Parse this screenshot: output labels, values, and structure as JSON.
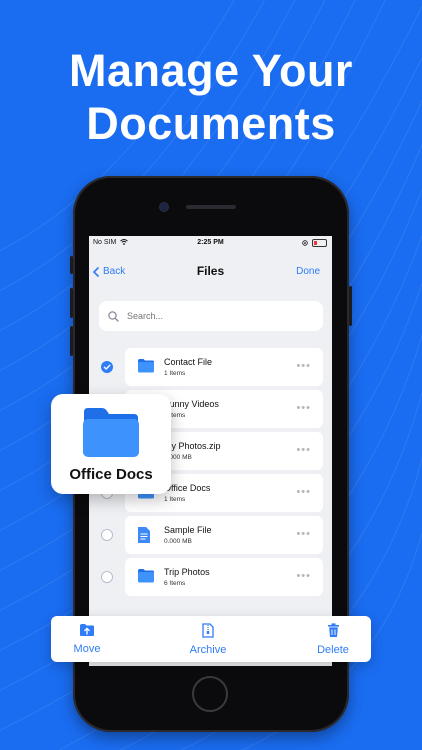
{
  "headline": {
    "line1": "Manage Your",
    "line2": "Documents"
  },
  "colors": {
    "background": "#1a6cf0",
    "accent": "#2f7cf6",
    "folder": "#2f86f6"
  },
  "status_bar": {
    "carrier": "No SIM",
    "time": "2:25 PM"
  },
  "nav": {
    "back_label": "Back",
    "title": "Files",
    "done_label": "Done"
  },
  "search": {
    "placeholder": "Search..."
  },
  "files": [
    {
      "name": "Contact File",
      "meta": "1 Items",
      "icon": "folder-icon",
      "selected": true
    },
    {
      "name": "Funny Videos",
      "meta": "1 Items",
      "icon": "folder-icon",
      "selected": false
    },
    {
      "name": "My Photos.zip",
      "meta": "0.000 MB",
      "icon": "zip-icon",
      "selected": false
    },
    {
      "name": "Office Docs",
      "meta": "1 Items",
      "icon": "folder-icon",
      "selected": false
    },
    {
      "name": "Sample File",
      "meta": "0.000 MB",
      "icon": "document-icon",
      "selected": false
    },
    {
      "name": "Trip Photos",
      "meta": "6 Items",
      "icon": "folder-icon",
      "selected": false
    }
  ],
  "highlight_card": {
    "label": "Office Docs",
    "icon": "folder-icon"
  },
  "toolbar": {
    "move_label": "Move",
    "archive_label": "Archive",
    "delete_label": "Delete"
  }
}
